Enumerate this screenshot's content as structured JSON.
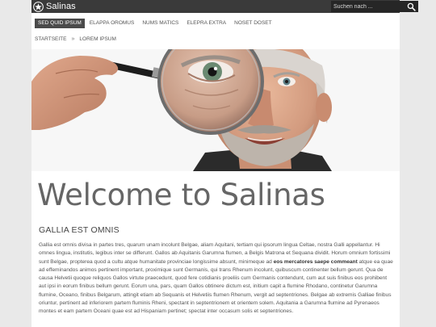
{
  "site": {
    "name": "Salinas"
  },
  "search": {
    "placeholder": "Suchen nach ..."
  },
  "nav": {
    "items": [
      {
        "label": "SED QUID IPSUM",
        "active": true
      },
      {
        "label": "ELAPPA OROMUS",
        "active": false
      },
      {
        "label": "NUMS MATICS",
        "active": false
      },
      {
        "label": "ELEPRA EXTRA",
        "active": false
      },
      {
        "label": "NOSET DOSET",
        "active": false
      }
    ]
  },
  "breadcrumb": {
    "home": "STARTSEITE",
    "separator": "»",
    "current": "LOREM IPSUM"
  },
  "content": {
    "welcome": "Welcome to Salinas",
    "section_title": "GALLIA EST OMNIS",
    "paragraph_part1": "Gallia est omnis divisa in partes tres, quarum unam incolunt Belgae, aliam Aquitani, tertiam qui ipsorum lingua Celtae, nostra Galli appellantur. Hi omnes lingua, institutis, legibus inter se differunt. Gallos ab Aquitanis Garumna flumen, a Belgis Matrona et Sequana dividit. Horum omnium fortissimi sunt Belgae, propterea quod a cultu atque humanitate provinciae longissime absunt, minimeque ad",
    "paragraph_bold": "eos mercatores saepe commeant",
    "paragraph_part2": "atque ea quae ad effeminandos animos pertinent important, proximique sunt Germanis, qui trans Rhenum incolunt, quibuscum continenter bellum gerunt. Qua de causa Helvetii quoque reliquos Gallos virtute praecedunt, quod fere cotidianis proeliis cum Germanis contendunt, cum aut suis finibus eos prohibent aut ipsi in eorum finibus bellum gerunt. Eorum una, pars, quam Gallos obtinere dictum est, initium capit a flumine Rhodano, continetur Garumna flumine, Oceano, finibus Belgarum, attingit etiam ab Sequanis et Helvetiis flumen Rhenum, vergit ad septentriones. Belgae ab extremis Galliae finibus oriuntur, pertinent ad inferiorem partem fluminis Rheni, spectant in septentrionem et orientem solem. Aquitania a Garumna flumine ad Pyrenaeos montes et eam partem Oceani quae est ad Hispaniam pertinet; spectat inter occasum solis et septentriones."
  },
  "colors": {
    "topbar": "#3a3a3a",
    "nav_active": "#4a4a4a",
    "page_bg": "#ffffff",
    "outer_bg": "#e9e9e9"
  },
  "icons": {
    "logo": "star-circle-icon",
    "search": "magnifier-icon"
  }
}
